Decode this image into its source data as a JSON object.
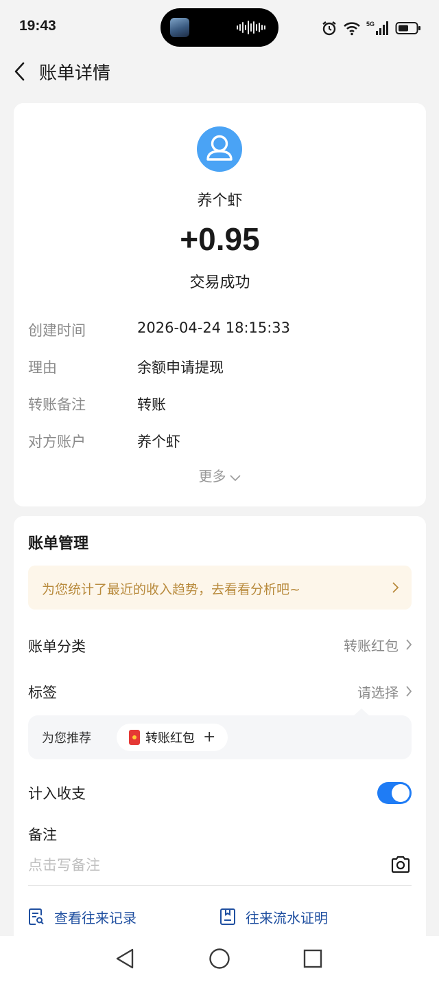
{
  "status_bar": {
    "time": "19:43",
    "network": "5G",
    "icons": [
      "alarm-icon",
      "wifi-icon",
      "signal-icon",
      "battery-icon"
    ]
  },
  "header": {
    "title": "账单详情",
    "back_icon": "chevron-left-icon"
  },
  "bill": {
    "payee": "养个虾",
    "amount": "+0.95",
    "status": "交易成功",
    "details": [
      {
        "label": "创建时间",
        "value": "2026-04-24 18:15:33"
      },
      {
        "label": "理由",
        "value": "余额申请提现"
      },
      {
        "label": "转账备注",
        "value": "转账"
      },
      {
        "label": "对方账户",
        "value": "养个虾"
      }
    ],
    "more_label": "更多"
  },
  "management": {
    "title": "账单管理",
    "promo_text": "为您统计了最近的收入趋势，去看看分析吧~",
    "category_label": "账单分类",
    "category_value": "转账红包",
    "tag_label": "标签",
    "tag_value": "请选择",
    "recommend_label": "为您推荐",
    "recommend_chip": "转账红包",
    "recommend_plus": "+",
    "include_label": "计入收支",
    "include_enabled": true,
    "note_label": "备注",
    "note_placeholder": "点击写备注",
    "links": [
      {
        "label": "查看往来记录",
        "icon": "record-search-icon"
      },
      {
        "label": "往来流水证明",
        "icon": "certificate-icon"
      }
    ]
  },
  "colors": {
    "accent": "#1f7cf5",
    "avatar_bg": "#4aa3f5",
    "promo_bg": "#fdf6ea",
    "promo_text": "#b88a3c",
    "link": "#1f4fa0"
  }
}
